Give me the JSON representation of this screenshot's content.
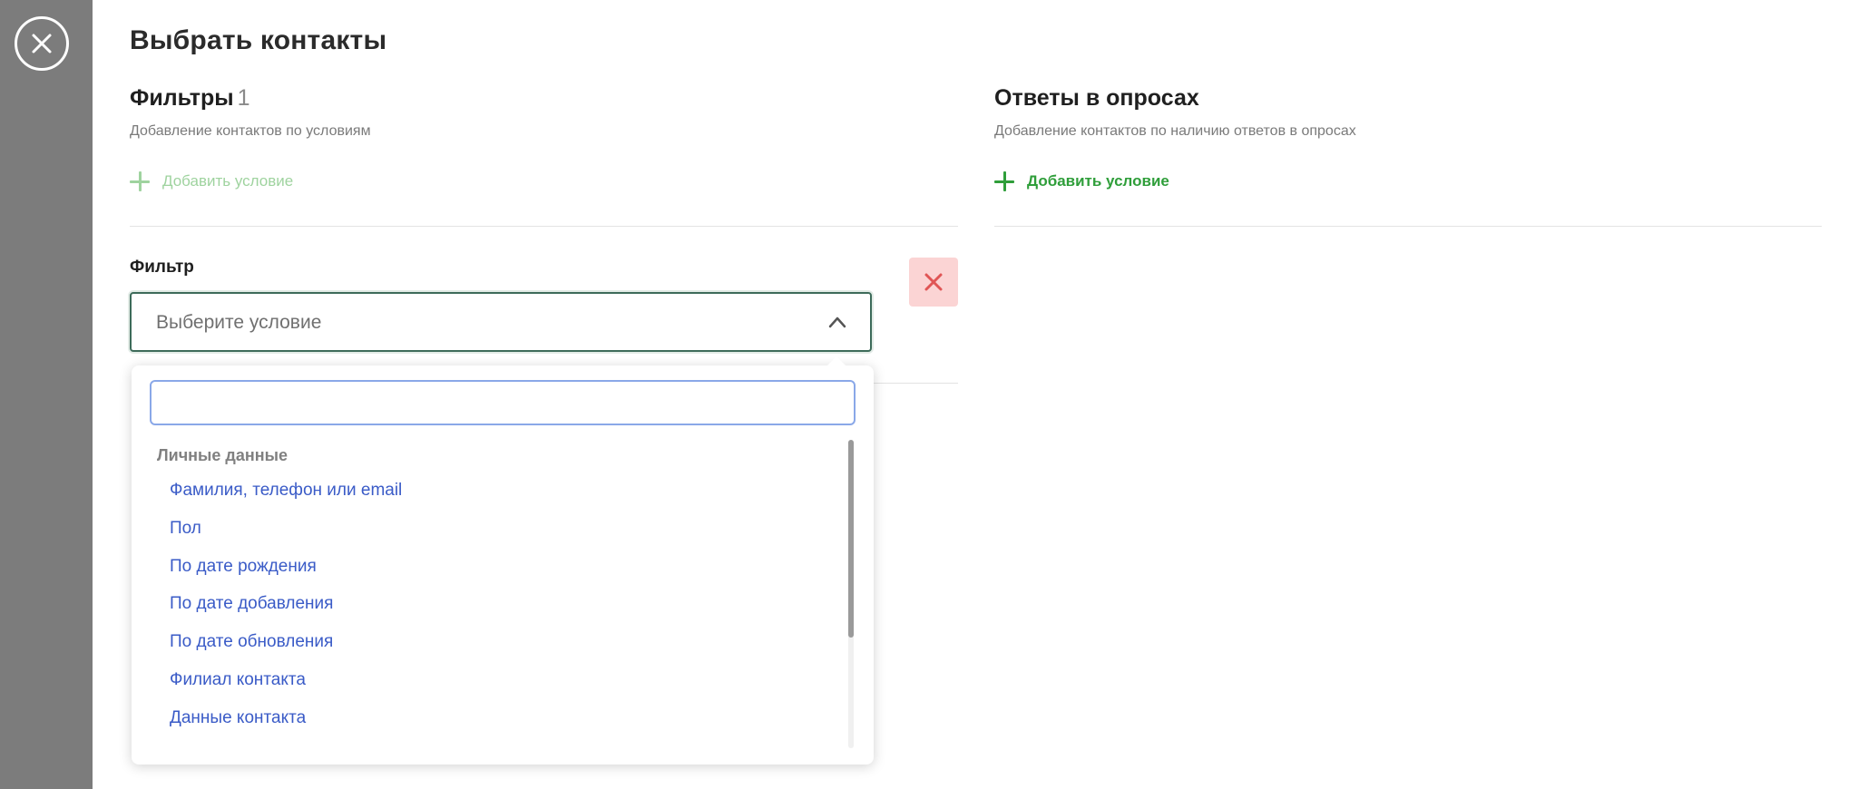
{
  "page": {
    "title": "Выбрать контакты"
  },
  "filters_section": {
    "title": "Фильтры",
    "count": "1",
    "subtitle": "Добавление контактов по условиям",
    "add_label": "Добавить условие"
  },
  "answers_section": {
    "title": "Ответы в опросах",
    "subtitle": "Добавление контактов по наличию ответов в опросах",
    "add_label": "Добавить условие"
  },
  "filter": {
    "label": "Фильтр",
    "select_placeholder": "Выберите условие"
  },
  "dropdown": {
    "search_value": "",
    "group_label": "Личные данные",
    "options": [
      {
        "label": "Фамилия, телефон или email"
      },
      {
        "label": "Пол"
      },
      {
        "label": "По дате рождения"
      },
      {
        "label": "По дате добавления"
      },
      {
        "label": "По дате обновления"
      },
      {
        "label": "Филиал контакта"
      },
      {
        "label": "Данные контакта"
      }
    ]
  },
  "icons": {
    "close": "close-circle-icon",
    "plus": "plus-icon",
    "chevron": "chevron-up-icon",
    "delete": "x-icon"
  },
  "colors": {
    "overlay": "#7c7c7c",
    "accent_green": "#2f9e3a",
    "link_blue": "#3a5bc7",
    "danger_bg": "#fbd4d4",
    "danger_icon": "#e05555"
  }
}
